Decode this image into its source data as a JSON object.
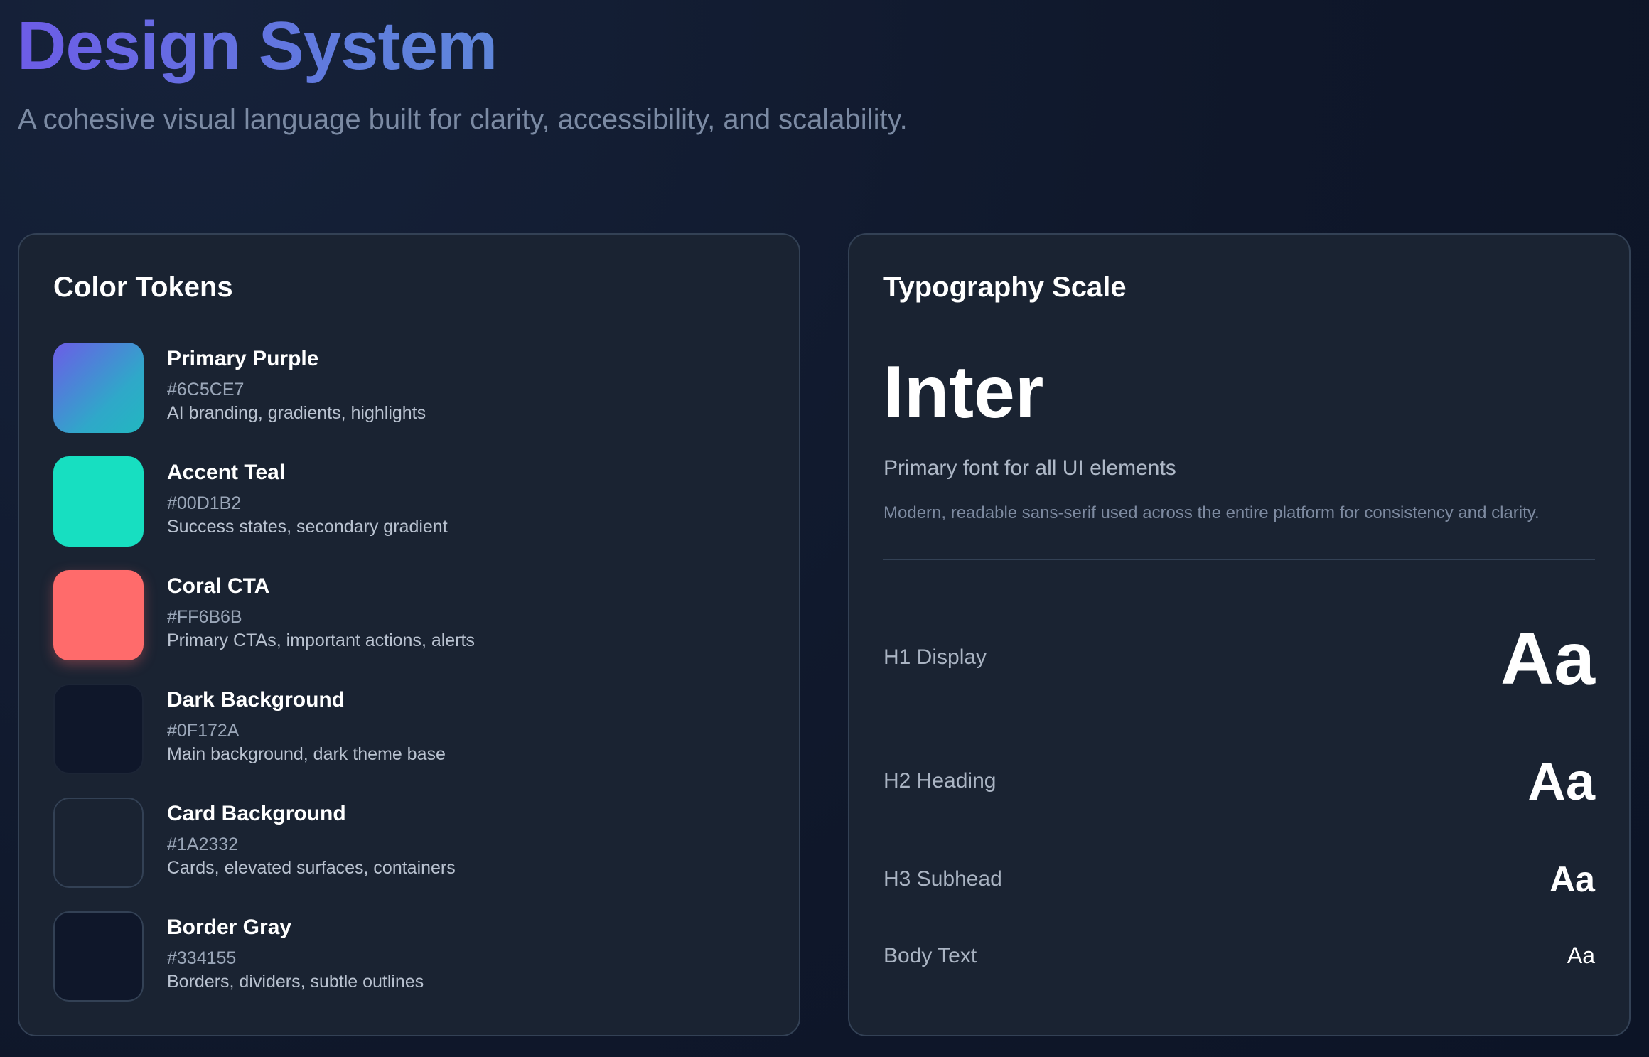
{
  "header": {
    "title": "Design System",
    "subtitle": "A cohesive visual language built for clarity, accessibility, and scalability."
  },
  "colors_card": {
    "title": "Color Tokens",
    "tokens": [
      {
        "name": "Primary Purple",
        "hex": "#6C5CE7",
        "usage": "AI branding, gradients, highlights"
      },
      {
        "name": "Accent Teal",
        "hex": "#00D1B2",
        "usage": "Success states, secondary gradient"
      },
      {
        "name": "Coral CTA",
        "hex": "#FF6B6B",
        "usage": "Primary CTAs, important actions, alerts"
      },
      {
        "name": "Dark Background",
        "hex": "#0F172A",
        "usage": "Main background, dark theme base"
      },
      {
        "name": "Card Background",
        "hex": "#1A2332",
        "usage": "Cards, elevated surfaces, containers"
      },
      {
        "name": "Border Gray",
        "hex": "#334155",
        "usage": "Borders, dividers, subtle outlines"
      }
    ]
  },
  "typography_card": {
    "title": "Typography Scale",
    "font_name": "Inter",
    "font_purpose": "Primary font for all UI elements",
    "font_description": "Modern, readable sans-serif used across the entire platform for consistency and clarity.",
    "scale": [
      {
        "label": "H1 Display",
        "sample": "Aa"
      },
      {
        "label": "H2 Heading",
        "sample": "Aa"
      },
      {
        "label": "H3 Subhead",
        "sample": "Aa"
      },
      {
        "label": "Body Text",
        "sample": "Aa"
      }
    ]
  }
}
